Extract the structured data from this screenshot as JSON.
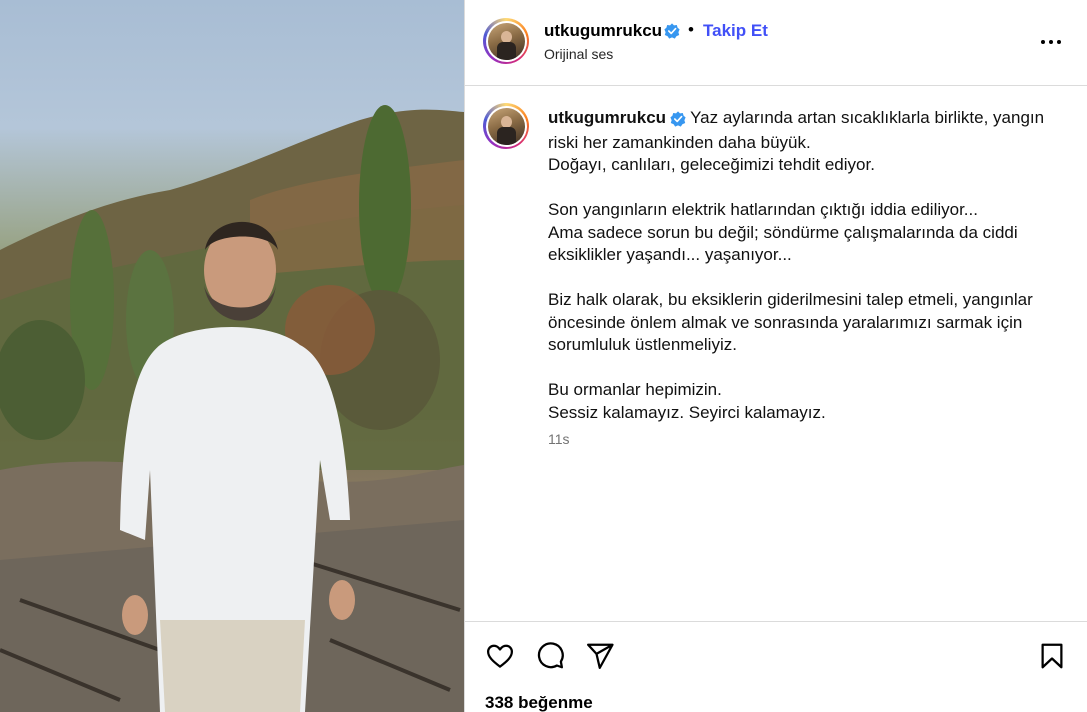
{
  "post": {
    "username": "utkugumrukcu",
    "follow_label": "Takip Et",
    "separator": "•",
    "audio_label": "Orijinal ses",
    "caption_first": "Yaz aylarında artan sıcaklıklarla birlikte, yangın riski her zamankinden daha büyük.",
    "caption_lines": [
      "Doğayı, canlıları, geleceğimizi tehdit ediyor.",
      "",
      "Son yangınların elektrik hatlarından çıktığı iddia ediliyor...",
      "Ama sadece sorun bu değil; söndürme çalışmalarında da ciddi eksiklikler yaşandı... yaşanıyor...",
      "",
      "Biz halk olarak, bu eksiklerin giderilmesini talep etmeli, yangınlar öncesinde önlem almak ve sonrasında yaralarımızı sarmak için sorumluluk üstlenmeliyiz.",
      "",
      "Bu ormanlar hepimizin.",
      "Sessiz kalamayız. Seyirci kalamayız."
    ],
    "time_ago": "11s",
    "likes_text": "338 beğenme"
  },
  "icons": {
    "verified": "verified-badge-icon",
    "more": "more-options-icon",
    "like": "heart-icon",
    "comment": "comment-icon",
    "share": "share-icon",
    "save": "bookmark-icon"
  },
  "colors": {
    "follow": "#4150f7",
    "verified": "#3797f0",
    "border": "#dbdbdb",
    "secondary": "#737373"
  }
}
